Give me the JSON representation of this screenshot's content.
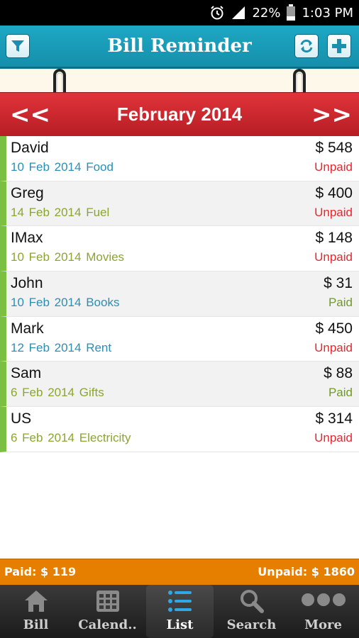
{
  "status_bar": {
    "battery": "22%",
    "time": "1:03 PM"
  },
  "app_bar": {
    "title": "Bill Reminder"
  },
  "month_nav": {
    "prev": "<<",
    "title": "February 2014",
    "next": ">>"
  },
  "bills": [
    {
      "name": "David",
      "date": "10 Feb 2014",
      "category": "Food",
      "amount": "$ 548",
      "status": "Unpaid",
      "meta_color": "#2a8fb5"
    },
    {
      "name": "Greg",
      "date": "14 Feb 2014",
      "category": "Fuel",
      "amount": "$ 400",
      "status": "Unpaid",
      "meta_color": "#8aa62e"
    },
    {
      "name": "IMax",
      "date": "10 Feb 2014",
      "category": "Movies",
      "amount": "$ 148",
      "status": "Unpaid",
      "meta_color": "#8aa62e"
    },
    {
      "name": "John",
      "date": "10 Feb 2014",
      "category": "Books",
      "amount": "$ 31",
      "status": "Paid",
      "meta_color": "#2a8fb5"
    },
    {
      "name": "Mark",
      "date": "12 Feb 2014",
      "category": "Rent",
      "amount": "$ 450",
      "status": "Unpaid",
      "meta_color": "#2a8fb5"
    },
    {
      "name": "Sam",
      "date": "6 Feb 2014",
      "category": "Gifts",
      "amount": "$ 88",
      "status": "Paid",
      "meta_color": "#8aa62e"
    },
    {
      "name": "US",
      "date": "6 Feb 2014",
      "category": "Electricity",
      "amount": "$ 314",
      "status": "Unpaid",
      "meta_color": "#8aa62e"
    }
  ],
  "status_colors": {
    "Unpaid": "#e8262c",
    "Paid": "#6f9a22"
  },
  "totals": {
    "paid": "Paid: $ 119",
    "unpaid": "Unpaid: $ 1860"
  },
  "tabs": [
    {
      "label": "Bill",
      "icon": "home-icon"
    },
    {
      "label": "Calend..",
      "icon": "calendar-icon"
    },
    {
      "label": "List",
      "icon": "list-icon"
    },
    {
      "label": "Search",
      "icon": "search-icon"
    },
    {
      "label": "More",
      "icon": "more-icon"
    }
  ],
  "active_tab": "List",
  "colors": {
    "app_bar": "#1ea8c4",
    "month_bar": "#c8262c",
    "totals_bar": "#e67e00",
    "row_accent": "#7bc043"
  }
}
